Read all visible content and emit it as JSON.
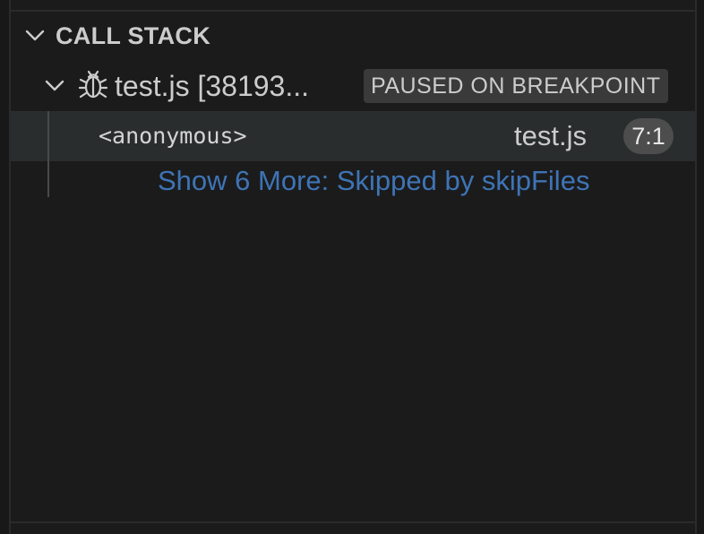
{
  "call_stack": {
    "title": "CALL STACK",
    "session": {
      "name": "test.js [38193...",
      "status": "PAUSED ON BREAKPOINT",
      "icon": "bug-icon"
    },
    "frames": [
      {
        "name": "<anonymous>",
        "file": "test.js",
        "position": "7:1"
      }
    ],
    "show_more_label": "Show 6 More: Skipped by skipFiles"
  },
  "colors": {
    "background": "#1b1b1c",
    "selected_row": "#2a2d2e",
    "link": "#3e74b5",
    "badge": "#3a3a3a",
    "position_pill": "#4d4d4d",
    "text": "#cccccc"
  }
}
